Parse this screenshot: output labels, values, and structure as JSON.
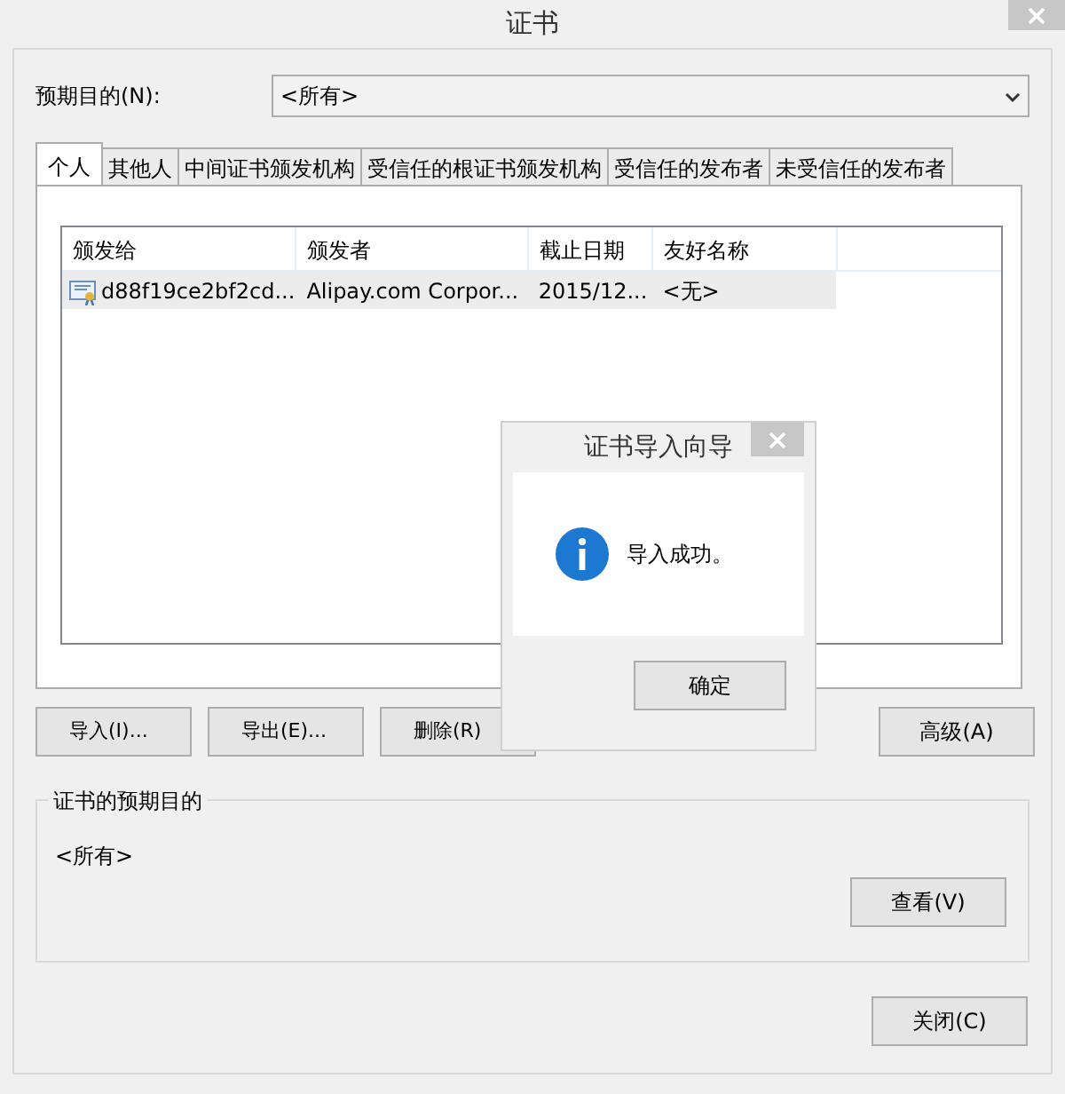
{
  "window": {
    "title": "证书"
  },
  "purpose": {
    "label": "预期目的(N):",
    "value": "<所有>"
  },
  "tabs": [
    {
      "label": "个人",
      "selected": true
    },
    {
      "label": "其他人",
      "selected": false
    },
    {
      "label": "中间证书颁发机构",
      "selected": false
    },
    {
      "label": "受信任的根证书颁发机构",
      "selected": false
    },
    {
      "label": "受信任的发布者",
      "selected": false
    },
    {
      "label": "未受信任的发布者",
      "selected": false
    }
  ],
  "table": {
    "columns": [
      "颁发给",
      "颁发者",
      "截止日期",
      "友好名称"
    ],
    "rows": [
      {
        "cells": [
          "d88f19ce2bf2cd...",
          "Alipay.com Corpor...",
          "2015/12...",
          "<无>"
        ],
        "selected": true
      }
    ]
  },
  "actions": [
    "导入(I)...",
    "导出(E)...",
    "删除(R)"
  ],
  "advanced_button": "高级(A)",
  "purposes_group": {
    "title": "证书的预期目的",
    "text": "<所有>",
    "view_button": "查看(V)"
  },
  "close_button": "关闭(C)",
  "dialog": {
    "title": "证书导入向导",
    "message": "导入成功。",
    "ok_button": "确定"
  }
}
